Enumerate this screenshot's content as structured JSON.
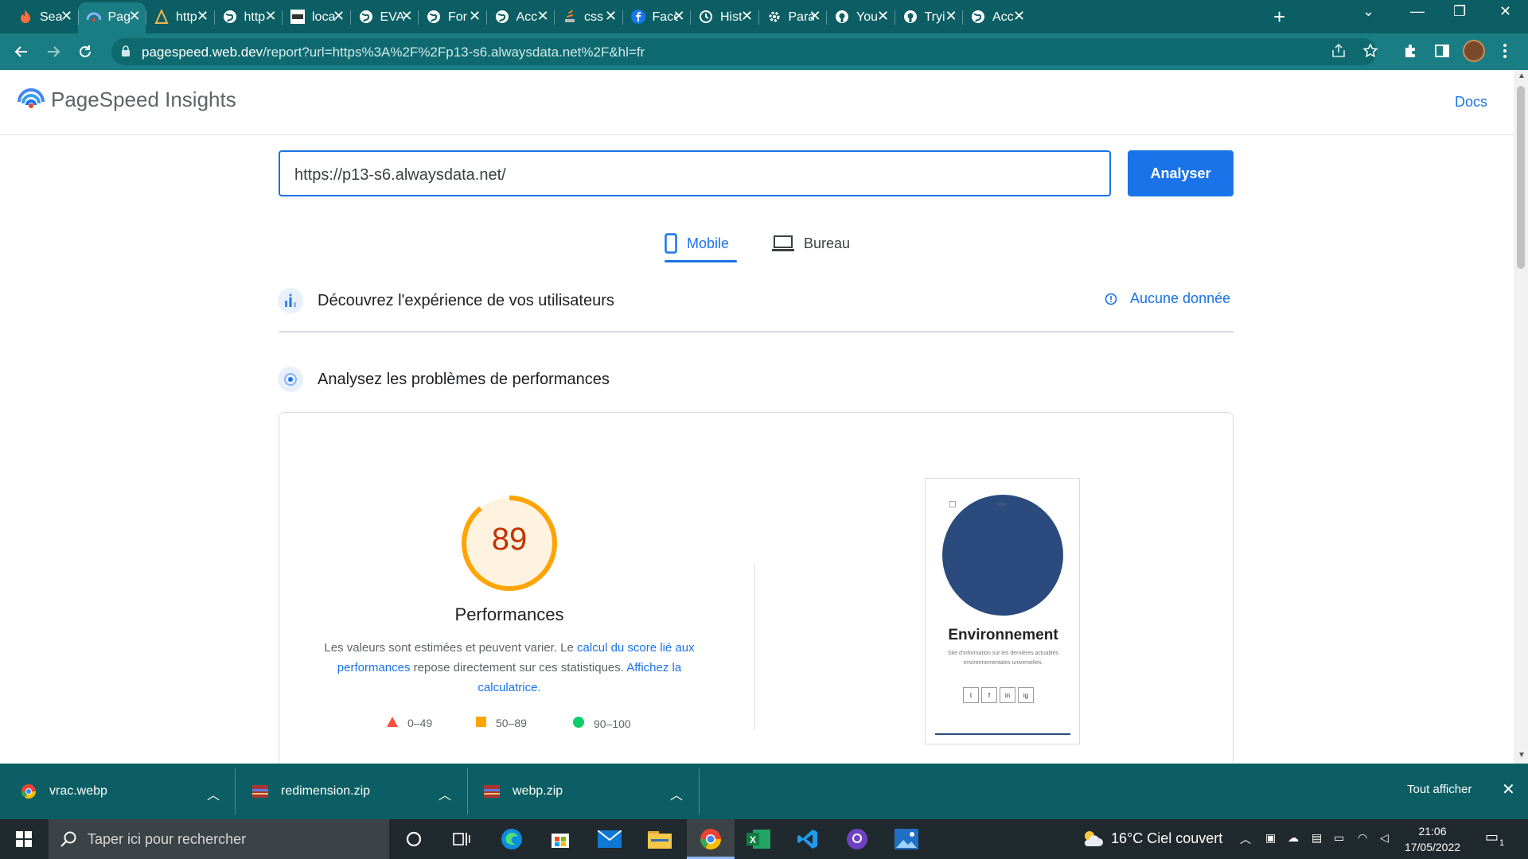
{
  "browser": {
    "tabs": [
      {
        "label": "Sea",
        "icon": "fire-icon"
      },
      {
        "label": "Pag",
        "icon": "pagespeed-icon",
        "active": true
      },
      {
        "label": "http",
        "icon": "tower-icon"
      },
      {
        "label": "http",
        "icon": "globe-icon"
      },
      {
        "label": "loca",
        "icon": "image-icon"
      },
      {
        "label": "EVA",
        "icon": "globe-icon"
      },
      {
        "label": "For",
        "icon": "globe-icon"
      },
      {
        "label": "Acc",
        "icon": "globe-icon"
      },
      {
        "label": "css",
        "icon": "stack-icon"
      },
      {
        "label": "Face",
        "icon": "facebook-icon"
      },
      {
        "label": "Hist",
        "icon": "history-icon"
      },
      {
        "label": "Para",
        "icon": "gear-icon"
      },
      {
        "label": "You",
        "icon": "github-icon"
      },
      {
        "label": "Tryi",
        "icon": "github-icon"
      },
      {
        "label": "Acc",
        "icon": "globe-icon"
      }
    ],
    "url_host": "pagespeed.web.dev",
    "url_path": "/report?url=https%3A%2F%2Fp13-s6.alwaysdata.net%2F&hl=fr"
  },
  "header": {
    "title": "PageSpeed Insights",
    "docs": "Docs"
  },
  "form": {
    "url_value": "https://p13-s6.alwaysdata.net/",
    "analyse_label": "Analyser"
  },
  "device_tabs": {
    "mobile": "Mobile",
    "desktop": "Bureau"
  },
  "sections": {
    "discover": "Découvrez l'expérience de vos utilisateurs",
    "no_data": "Aucune donnée",
    "analyse": "Analysez les problèmes de performances"
  },
  "performance": {
    "score": "89",
    "score_value": 89,
    "label": "Performances",
    "desc_1": "Les valeurs sont estimées et peuvent varier. Le ",
    "link_1": "calcul du score lié aux performances",
    "desc_2": " repose directement sur ces statistiques. ",
    "link_2": "Affichez la calculatrice",
    "desc_3": ".",
    "legend": [
      {
        "range": "0–49",
        "color": "#ff4e42"
      },
      {
        "range": "50–89",
        "color": "#ffa400"
      },
      {
        "range": "90–100",
        "color": "#0cce6b"
      }
    ],
    "gauge_color": "#ffa400",
    "gauge_bg": "#fff3e0"
  },
  "screenshot": {
    "image_alt": "logo",
    "title": "Environnement",
    "subtitle": "Site d'information sur les dernières actualités environnementales universelles.",
    "socials": [
      "t",
      "f",
      "in",
      "ig"
    ]
  },
  "downloads": [
    {
      "name": "vrac.webp"
    },
    {
      "name": "redimension.zip"
    },
    {
      "name": "webp.zip"
    }
  ],
  "downloads_show_all": "Tout afficher",
  "taskbar": {
    "search_placeholder": "Taper ici pour rechercher",
    "weather": "16°C  Ciel couvert",
    "time": "21:06",
    "date": "17/05/2022",
    "notifications": "1"
  }
}
